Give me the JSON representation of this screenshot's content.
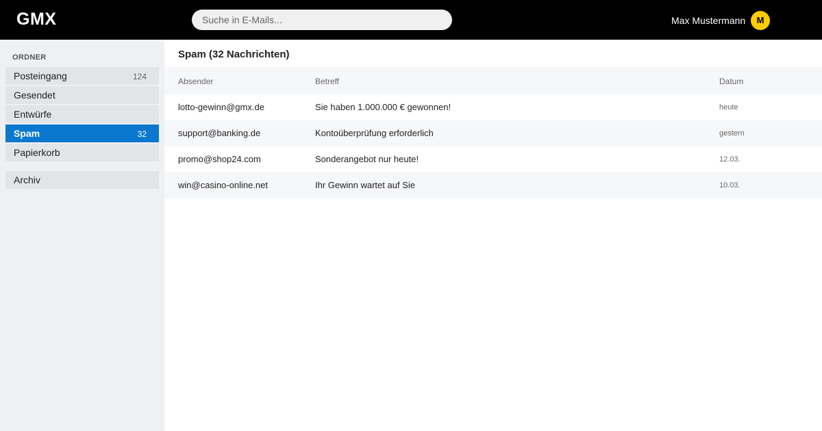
{
  "app": {
    "logo": "GMX",
    "search_placeholder": "Suche in E-Mails...",
    "user_name": "Max Mustermann",
    "avatar_initial": "M"
  },
  "sidebar": {
    "heading": "ORDNER",
    "folders": [
      {
        "label": "Posteingang",
        "count": "124"
      },
      {
        "label": "Gesendet",
        "count": ""
      },
      {
        "label": "Entwürfe",
        "count": ""
      },
      {
        "label": "Spam",
        "count": "32"
      },
      {
        "label": "Papierkorb",
        "count": ""
      }
    ],
    "extra_folders": [
      {
        "label": "Archiv"
      }
    ]
  },
  "main": {
    "title": "Spam (32 Nachrichten)",
    "columns": {
      "sender": "Absender",
      "subject": "Betreff",
      "date": "Datum"
    },
    "messages": [
      {
        "sender": "lotto-gewinn@gmx.de",
        "subject": "Sie haben 1.000.000 € gewonnen!",
        "date": "heute"
      },
      {
        "sender": "support@banking.de",
        "subject": "Kontoüberprüfung erforderlich",
        "date": "gestern"
      },
      {
        "sender": "promo@shop24.com",
        "subject": "Sonderangebot nur heute!",
        "date": "12.03."
      },
      {
        "sender": "win@casino-online.net",
        "subject": "Ihr Gewinn wartet auf Sie",
        "date": "10.03."
      }
    ]
  },
  "colors": {
    "topbar": "#000000",
    "sidebar": "#eef0f3",
    "active_folder": "#0b78d0",
    "avatar": "#ffcc00"
  }
}
